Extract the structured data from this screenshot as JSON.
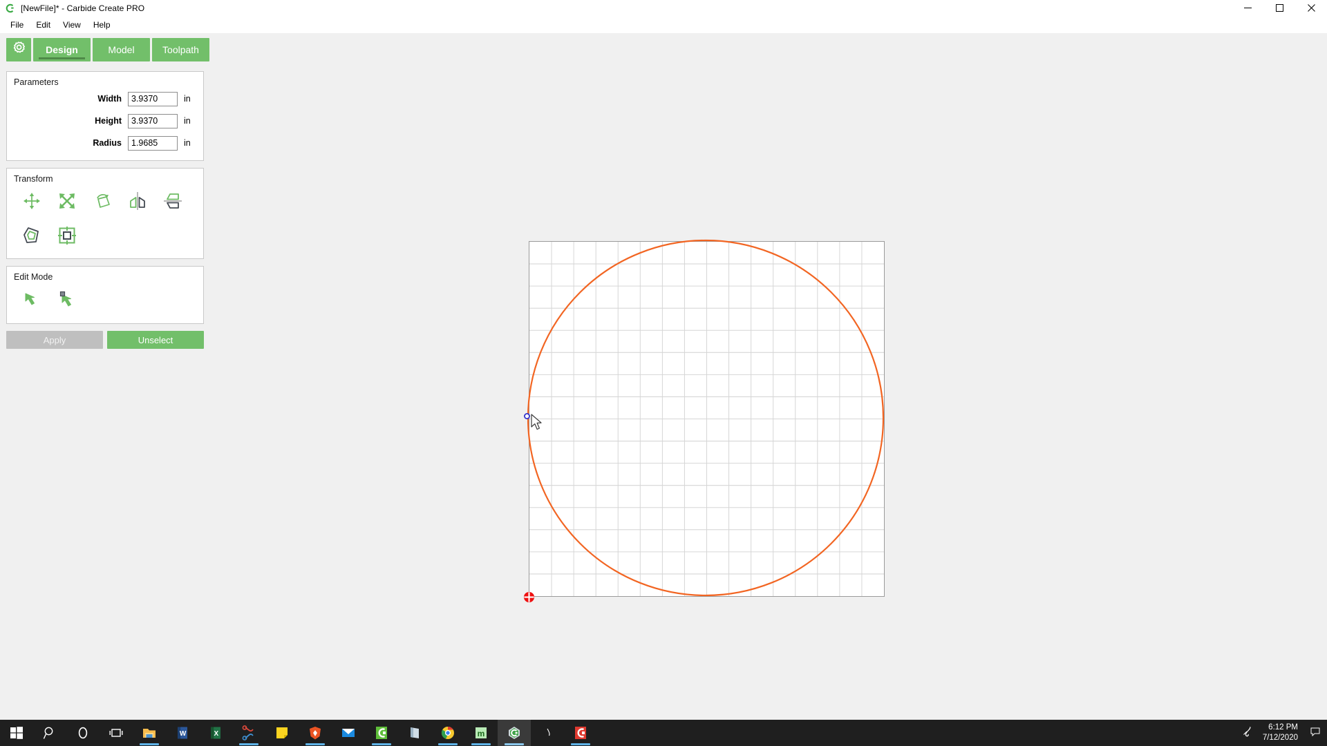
{
  "window": {
    "title": "[NewFile]* - Carbide Create PRO",
    "app_icon": "carbide-c-icon",
    "controls": {
      "minimize": "minimize-icon",
      "maximize": "maximize-icon",
      "close": "close-icon"
    }
  },
  "menubar": {
    "items": [
      {
        "label": "File"
      },
      {
        "label": "Edit"
      },
      {
        "label": "View"
      },
      {
        "label": "Help"
      }
    ]
  },
  "tabs": {
    "gear_icon": "gear-icon",
    "items": [
      {
        "label": "Design",
        "active": true
      },
      {
        "label": "Model",
        "active": false
      },
      {
        "label": "Toolpath",
        "active": false
      }
    ]
  },
  "parameters": {
    "title": "Parameters",
    "rows": [
      {
        "label": "Width",
        "value": "3.9370",
        "unit": "in"
      },
      {
        "label": "Height",
        "value": "3.9370",
        "unit": "in"
      },
      {
        "label": "Radius",
        "value": "1.9685",
        "unit": "in"
      }
    ]
  },
  "transform": {
    "title": "Transform",
    "tools": [
      {
        "name": "move-tool"
      },
      {
        "name": "scale-tool"
      },
      {
        "name": "rotate-tool"
      },
      {
        "name": "mirror-horizontal-tool"
      },
      {
        "name": "mirror-vertical-tool"
      },
      {
        "name": "offset-path-tool"
      },
      {
        "name": "array-align-tool"
      }
    ]
  },
  "edit_mode": {
    "title": "Edit Mode",
    "tools": [
      {
        "name": "select-cursor-tool"
      },
      {
        "name": "node-edit-cursor-tool"
      }
    ]
  },
  "actions": {
    "apply_label": "Apply",
    "apply_enabled": false,
    "unselect_label": "Unselect",
    "unselect_enabled": true
  },
  "canvas": {
    "stock_shape": "square-stock",
    "grid_visible": true,
    "grid_divisions": 16,
    "objects": [
      {
        "name": "circle-vector",
        "type": "circle",
        "color": "#f26522"
      }
    ],
    "origin_marker": "job-origin-icon",
    "selected_node": "shape-node-handle",
    "cursor": "arrow-cursor"
  },
  "colors": {
    "accent_green": "#72bf6a",
    "accent_green_dark": "#4e8a48",
    "shape_orange": "#f26522",
    "origin_red": "#e81123",
    "node_blue": "#3333cc",
    "panel_bg": "#ffffff",
    "app_bg": "#f0f0f0",
    "taskbar_bg": "#1f1f1f"
  },
  "taskbar": {
    "items": [
      {
        "name": "start-button",
        "icon": "windows-logo-icon",
        "state": "none"
      },
      {
        "name": "search-button",
        "icon": "search-icon",
        "state": "none"
      },
      {
        "name": "cortana-button",
        "icon": "cortana-circle-icon",
        "state": "none"
      },
      {
        "name": "task-view-button",
        "icon": "task-view-icon",
        "state": "none"
      },
      {
        "name": "file-explorer",
        "icon": "folder-icon",
        "state": "running"
      },
      {
        "name": "word-app",
        "icon": "word-w-icon",
        "state": "none"
      },
      {
        "name": "excel-app",
        "icon": "excel-x-icon",
        "state": "none"
      },
      {
        "name": "snipping-tool-app",
        "icon": "scissors-icon",
        "state": "running"
      },
      {
        "name": "sticky-notes-app",
        "icon": "sticky-note-icon",
        "state": "none"
      },
      {
        "name": "brave-browser",
        "icon": "brave-lion-icon",
        "state": "running"
      },
      {
        "name": "mail-app",
        "icon": "mail-envelope-icon",
        "state": "none"
      },
      {
        "name": "carbide-motion-app",
        "icon": "green-c-icon",
        "state": "running"
      },
      {
        "name": "onedrive-app",
        "icon": "book-icon",
        "state": "none"
      },
      {
        "name": "chrome-browser",
        "icon": "chrome-icon",
        "state": "running"
      },
      {
        "name": "meshcam-app",
        "icon": "m-letter-icon",
        "state": "running"
      },
      {
        "name": "carbide-create-app",
        "icon": "carbide-gem-icon",
        "state": "active"
      },
      {
        "name": "inkscape-app",
        "icon": "ink-drop-icon",
        "state": "none"
      },
      {
        "name": "carbide-red-app",
        "icon": "red-c-icon",
        "state": "running"
      }
    ],
    "tray": {
      "pen_icon": "ink-pen-icon",
      "time": "6:12 PM",
      "date": "7/12/2020",
      "notification_icon": "action-center-icon"
    }
  }
}
